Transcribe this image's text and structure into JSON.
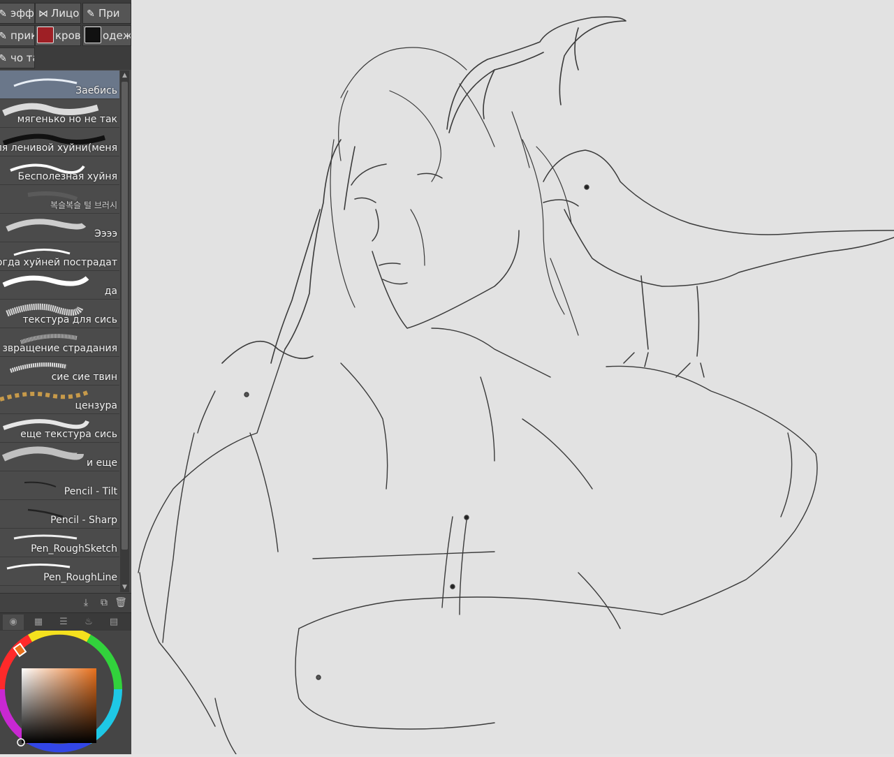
{
  "tool_tabs": [
    {
      "label": "эфф",
      "icon": "pen-nib-icon"
    },
    {
      "label": "Лицо",
      "icon": "bow-icon"
    },
    {
      "label": "При",
      "icon": "pen-nib-icon"
    },
    {
      "label": "прик",
      "icon": "pen-nib-icon"
    },
    {
      "label": "кров",
      "icon": "blood-icon",
      "icon_color": "#b8252d"
    },
    {
      "label": "одеж",
      "icon": "clothing-icon"
    },
    {
      "label": "чо та",
      "icon": "pen-nib-icon"
    }
  ],
  "brushes": [
    {
      "name": "Заебись",
      "selected": true
    },
    {
      "name": "мягенько но не так"
    },
    {
      "name": "ля ленивой хуйни(меня"
    },
    {
      "name": "Бесполезная хуйня"
    },
    {
      "name": "복슬복슬 털 브러시"
    },
    {
      "name": "Ээээ"
    },
    {
      "name": "огда хуйней пострадат"
    },
    {
      "name": "да"
    },
    {
      "name": "текстура для сись"
    },
    {
      "name": "звращение страдания"
    },
    {
      "name": "сие сие твин"
    },
    {
      "name": "цензура"
    },
    {
      "name": "еще текстура сись"
    },
    {
      "name": "и еще"
    },
    {
      "name": "Pencil - Tilt"
    },
    {
      "name": "Pencil - Sharp"
    },
    {
      "name": "Pen_RoughSketch"
    },
    {
      "name": "Pen_RoughLine"
    }
  ],
  "brush_actions": [
    {
      "icon": "import-brush-icon"
    },
    {
      "icon": "duplicate-brush-icon"
    },
    {
      "icon": "trash-icon"
    }
  ],
  "color_tabs": [
    {
      "icon": "color-wheel-icon"
    },
    {
      "icon": "color-set-icon"
    },
    {
      "icon": "sliders-icon"
    },
    {
      "icon": "intermediate-color-icon"
    },
    {
      "icon": "history-icon"
    }
  ],
  "color": {
    "current": "#e8701c",
    "hue_marker": "#e8701c"
  }
}
